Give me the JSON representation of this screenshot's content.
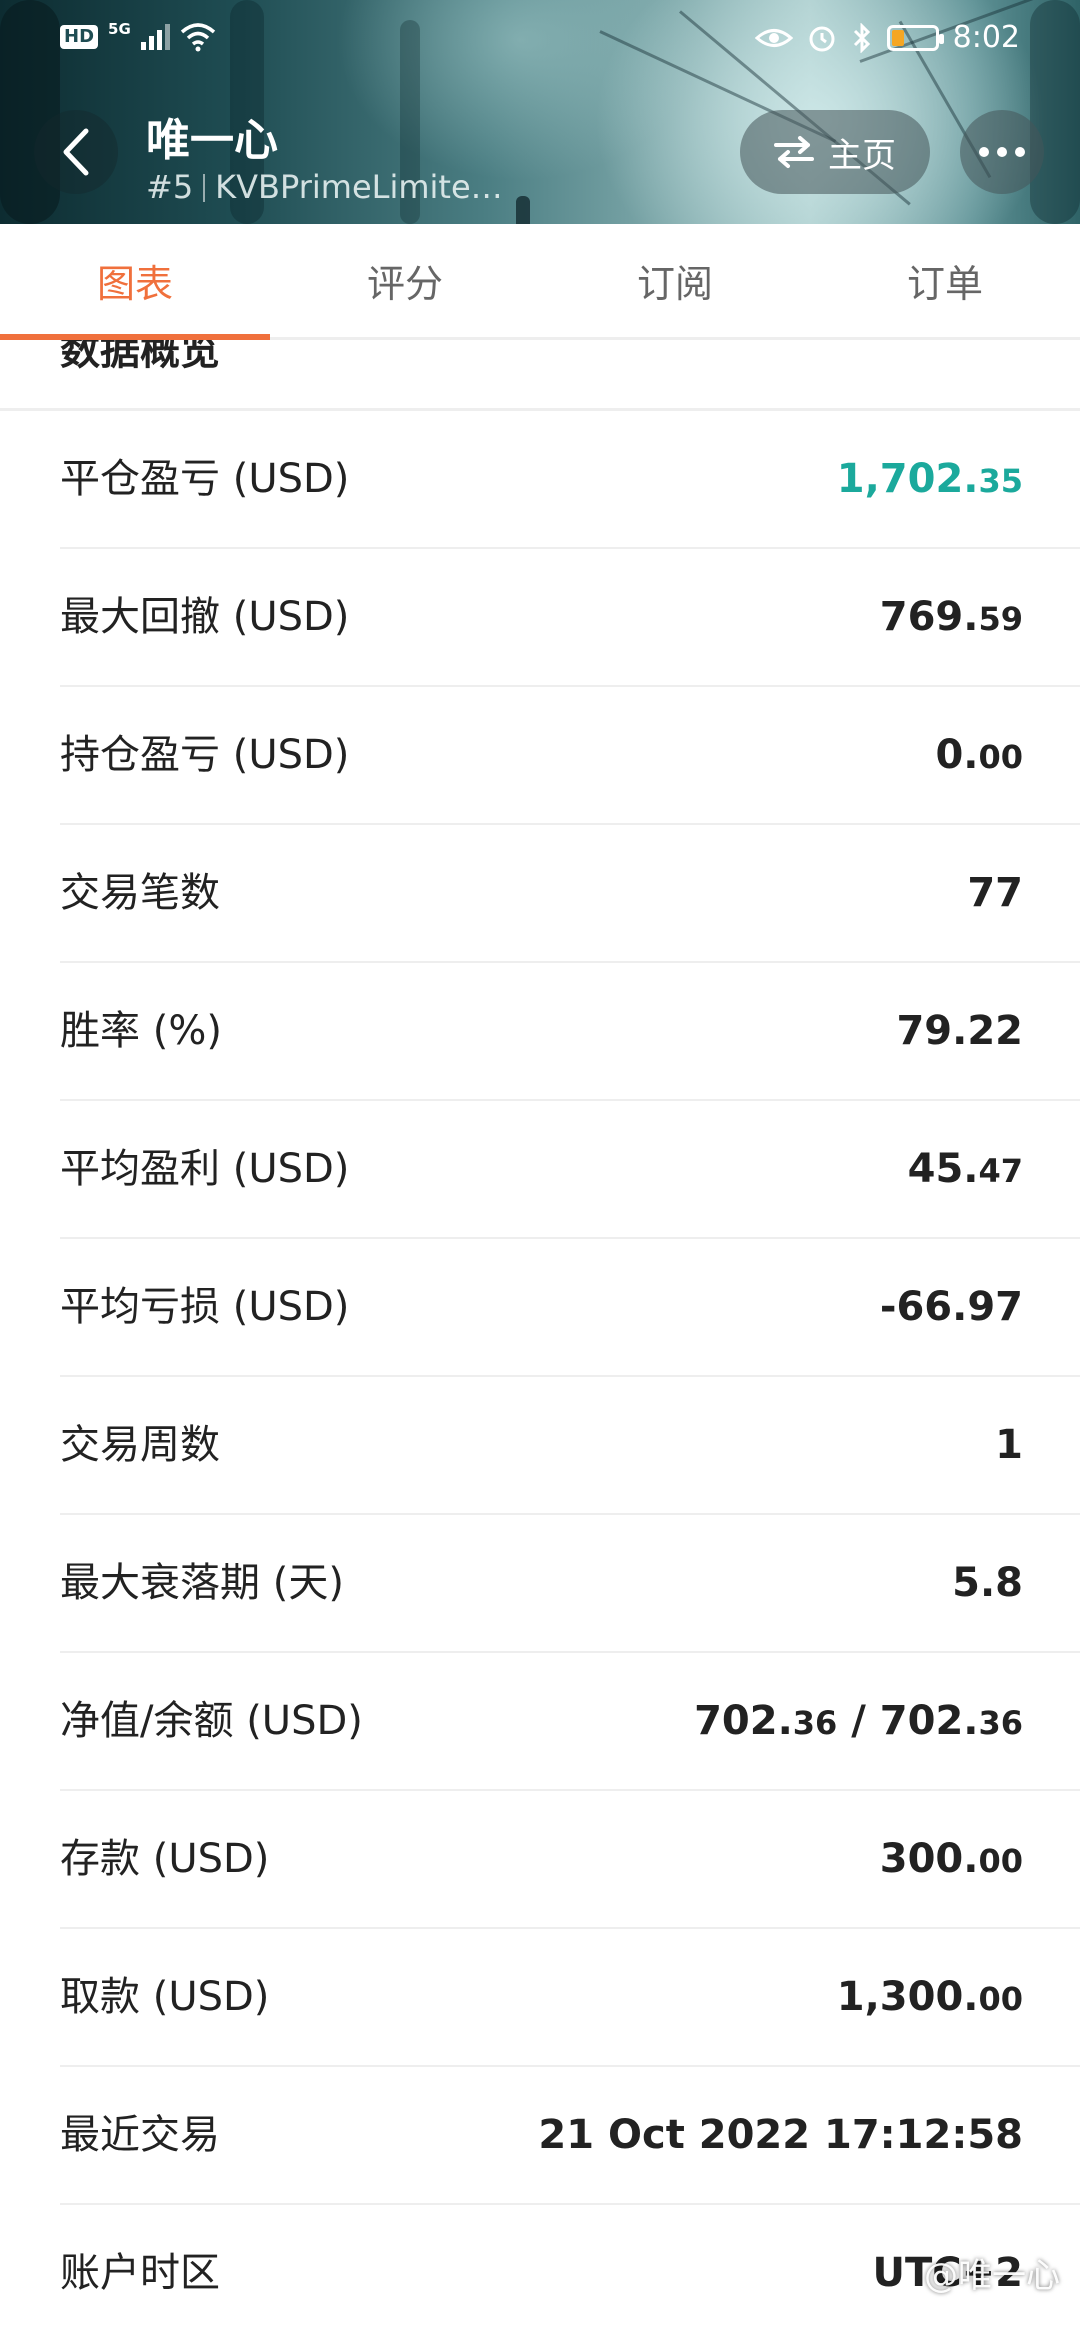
{
  "status_bar": {
    "hd_badge": "HD",
    "network": "5G",
    "time": "8:02",
    "icons": [
      "signal-icon",
      "wifi-icon",
      "eye-icon",
      "alarm-icon",
      "bluetooth-icon",
      "battery-icon"
    ],
    "battery_level_percent": 20
  },
  "header": {
    "title": "唯一心",
    "rank": "#5",
    "server": "KVBPrimeLimite…",
    "home_label": "主页",
    "colors": {
      "backdrop_dark": "#0d2c31",
      "backdrop_light": "#a9cbcb"
    }
  },
  "tabs": [
    {
      "label": "图表",
      "active": true
    },
    {
      "label": "评分",
      "active": false
    },
    {
      "label": "订阅",
      "active": false
    },
    {
      "label": "订单",
      "active": false
    }
  ],
  "section_title": "数据概览",
  "stats": [
    {
      "label": "平仓盈亏 (USD)",
      "main": "1,702.",
      "decimals": "35",
      "color": "#1ba99c"
    },
    {
      "label": "最大回撤 (USD)",
      "main": "769.",
      "decimals": "59"
    },
    {
      "label": "持仓盈亏 (USD)",
      "main": "0.",
      "decimals": "00"
    },
    {
      "label": "交易笔数",
      "main": "77",
      "decimals": ""
    },
    {
      "label": "胜率 (%)",
      "main": "79.22",
      "decimals": ""
    },
    {
      "label": "平均盈利 (USD)",
      "main": "45.",
      "decimals": "47"
    },
    {
      "label": "平均亏损 (USD)",
      "main": "-66.97",
      "decimals": ""
    },
    {
      "label": "交易周数",
      "main": "1",
      "decimals": ""
    },
    {
      "label": "最大衰落期 (天)",
      "main": "5.8",
      "decimals": ""
    },
    {
      "label": "净值/余额 (USD)",
      "main": "702.",
      "decimals": "36",
      "main2": " / 702.",
      "decimals2": "36"
    },
    {
      "label": "存款 (USD)",
      "main": "300.",
      "decimals": "00"
    },
    {
      "label": "取款 (USD)",
      "main": "1,300.",
      "decimals": "00"
    },
    {
      "label": "最近交易",
      "main": "21 Oct 2022 17:12:58",
      "decimals": ""
    },
    {
      "label": "账户时区",
      "main": "UTC+2",
      "decimals": ""
    }
  ],
  "watermark": "@唯一心",
  "accent_color": "#f0703c",
  "profit_color": "#1ba99c"
}
